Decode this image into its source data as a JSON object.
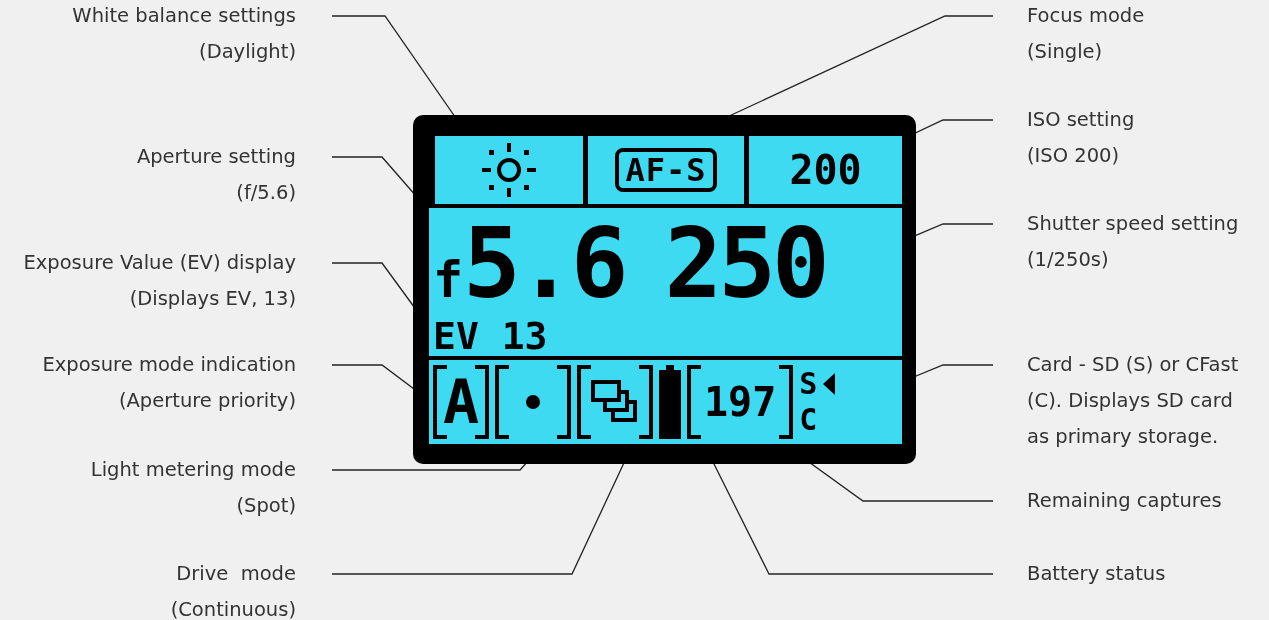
{
  "callouts_left": [
    {
      "lines": [
        "White balance settings",
        "(Daylight)"
      ]
    },
    {
      "lines": [
        "Aperture setting",
        "(f/5.6)"
      ]
    },
    {
      "lines": [
        "Exposure Value (EV) display",
        "(Displays EV, 13)"
      ]
    },
    {
      "lines": [
        "Exposure mode indication",
        "(Aperture priority)"
      ]
    },
    {
      "lines": [
        "Light metering mode",
        "(Spot)"
      ]
    },
    {
      "lines": [
        "Drive  mode",
        "(Continuous)"
      ]
    }
  ],
  "callouts_right": [
    {
      "lines": [
        "Focus mode",
        "(Single)"
      ]
    },
    {
      "lines": [
        "ISO setting",
        "(ISO 200)"
      ]
    },
    {
      "lines": [
        "Shutter speed setting",
        "(1/250s)"
      ]
    },
    {
      "lines": [
        "Card - SD (S) or CFast",
        "(C). Displays SD card",
        "as primary storage."
      ]
    },
    {
      "lines": [
        "Remaining captures"
      ]
    },
    {
      "lines": [
        "Battery status"
      ]
    }
  ],
  "lcd": {
    "focus_mode": "AF-S",
    "iso": "200",
    "aperture_prefix": "f",
    "aperture": "5.6",
    "shutter": "250",
    "ev": "EV 13",
    "exposure_mode": "A",
    "remaining": "197",
    "card_slots": [
      {
        "label": "S",
        "selected": true
      },
      {
        "label": "C",
        "selected": false
      }
    ]
  }
}
